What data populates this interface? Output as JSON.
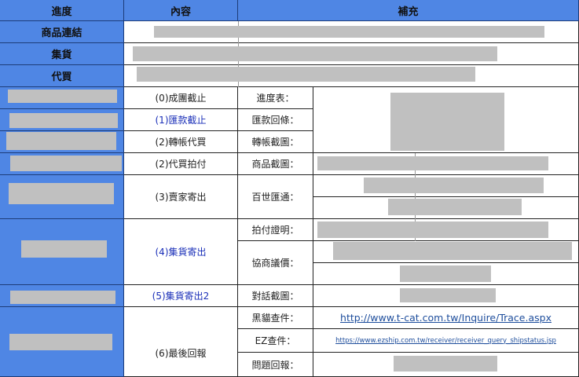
{
  "header": {
    "col1": "進度",
    "col2": "內容",
    "col3": "補充"
  },
  "top_rows": [
    {
      "label": "商品連結"
    },
    {
      "label": "集貨"
    },
    {
      "label": "代買"
    }
  ],
  "steps": [
    {
      "content": "(0)成團截止",
      "link": false
    },
    {
      "content": "(1)匯款截止",
      "link": true
    },
    {
      "content": "(2)轉帳代買",
      "link": false
    },
    {
      "content": "(2)代買拍付",
      "link": false
    },
    {
      "content": "(3)賣家寄出",
      "link": false
    },
    {
      "content": "(4)集貨寄出",
      "link": true
    },
    {
      "content": "(5)集貨寄出2",
      "link": true
    },
    {
      "content": "(6)最後回報",
      "link": false
    }
  ],
  "labels": [
    "進度表：",
    "匯款回條：",
    "轉帳截圖：",
    "商品截圖：",
    "百世匯通：",
    "拍付證明：",
    "協商議價：",
    "對話截圖：",
    "黑貓查件：",
    "EZ查件：",
    "問題回報："
  ],
  "links": {
    "tcat": "http://www.t-cat.com.tw/Inquire/Trace.aspx",
    "ezship": "https://www.ezship.com.tw/receiver/receiver_query_shipstatus.jsp"
  }
}
